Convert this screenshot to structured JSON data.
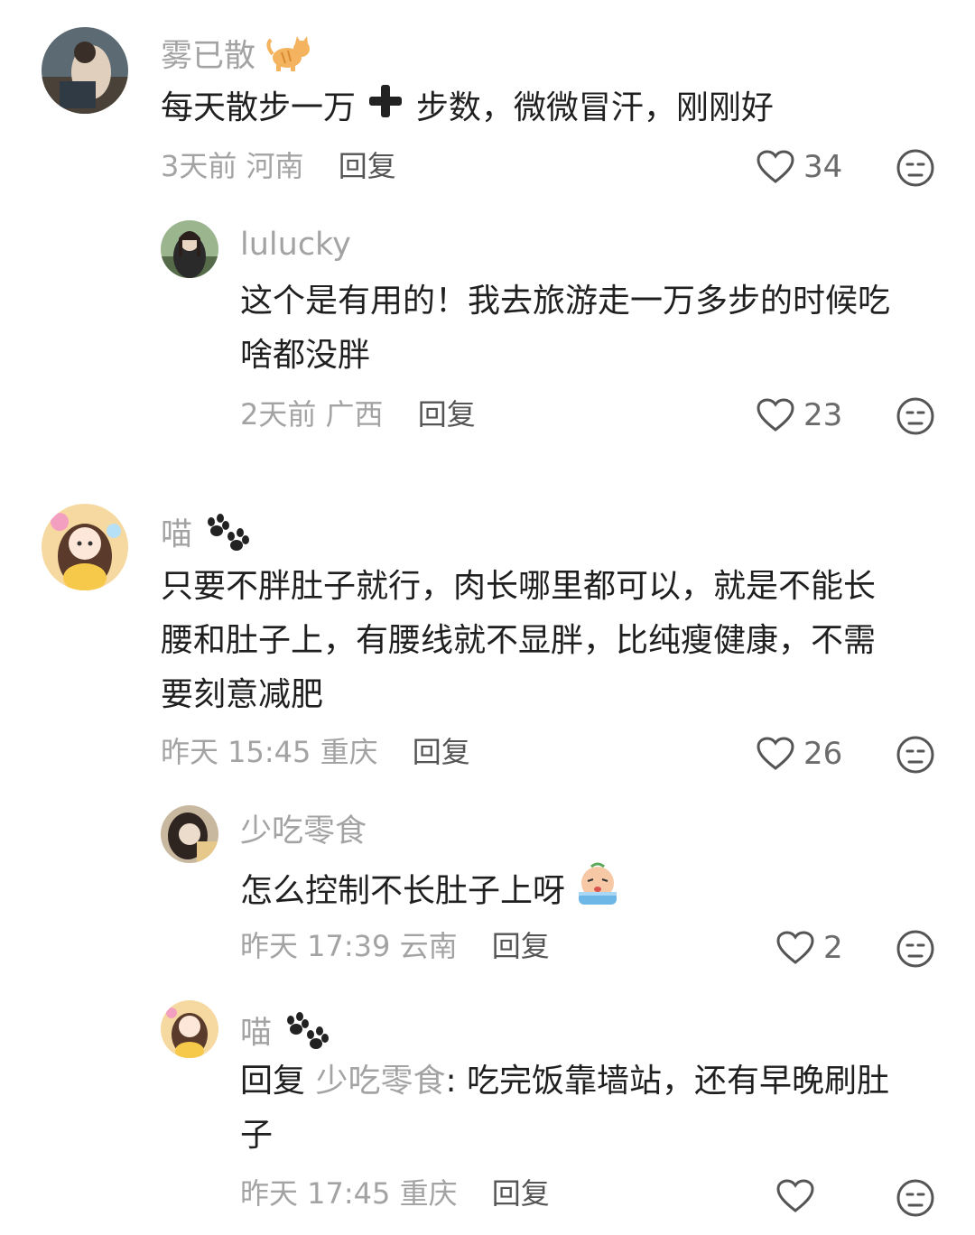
{
  "comments": [
    {
      "username": "雾已散",
      "username_emoji": "cat",
      "text_before": "每天散步一万",
      "text_after": "步数，微微冒汗，刚刚好",
      "time": "3天前",
      "location": "河南",
      "reply_label": "回复",
      "likes": "34",
      "avatar_palette": [
        "#4a5a66",
        "#d9c9b5",
        "#7d6a58"
      ]
    },
    {
      "username": "lulucky",
      "text_line1": "这个是有用的！我去旅游走一万多步的时候吃",
      "text_line2": "啥都没胖",
      "time": "2天前",
      "location": "广西",
      "reply_label": "回复",
      "likes": "23",
      "avatar_palette": [
        "#8fb08a",
        "#2d2d2d",
        "#e6d3c1"
      ]
    },
    {
      "username": "喵",
      "username_emoji": "paw",
      "text_line1": "只要不胖肚子就行，肉长哪里都可以，就是不能长",
      "text_line2": "腰和肚子上，有腰线就不显胖，比纯瘦健康，不需",
      "text_line3": "要刻意减肥",
      "time": "昨天 15:45",
      "location": "重庆",
      "reply_label": "回复",
      "likes": "26",
      "avatar_palette": [
        "#f3c66b",
        "#e88fb0",
        "#5a3a7a"
      ]
    },
    {
      "username": "少吃零食",
      "text_line1": "怎么控制不长肚子上呀",
      "time": "昨天 17:39",
      "location": "云南",
      "reply_label": "回复",
      "likes": "2",
      "avatar_palette": [
        "#3a3a3a",
        "#e9d8c6",
        "#b9a58c"
      ]
    },
    {
      "username": "喵",
      "username_emoji": "paw",
      "reply_prefix": "回复",
      "reply_target": "少吃零食",
      "text_line1": ": 吃完饭靠墙站，还有早晚刷肚",
      "text_line2": "子",
      "time": "昨天 17:45",
      "location": "重庆",
      "reply_label": "回复",
      "avatar_palette": [
        "#f3c66b",
        "#e88fb0",
        "#5a3a7a"
      ]
    }
  ],
  "icons": {
    "like": "heart-outline-icon",
    "dislike": "neutral-face-icon"
  },
  "colors": {
    "meta_gray": "#a3a3a3",
    "text": "#1f1f1f"
  }
}
